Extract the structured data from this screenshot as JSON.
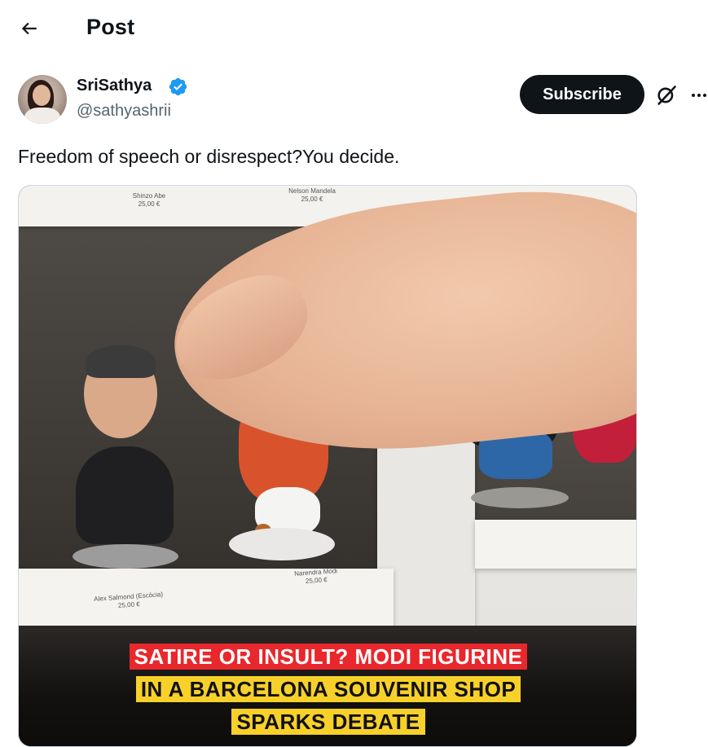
{
  "header": {
    "title": "Post",
    "back_icon": "arrow-left-icon"
  },
  "author": {
    "display_name": "SriSathya",
    "handle": "@sathyashrii",
    "verified": true,
    "verified_color": "#1d9bf0"
  },
  "actions": {
    "subscribe_label": "Subscribe",
    "grok_icon": "grok-icon",
    "more_icon": "more-horizontal-icon"
  },
  "tweet": {
    "text": "Freedom of speech or disrespect?You decide."
  },
  "media": {
    "price_tags": [
      {
        "name": "Shinzo Abe",
        "price": "25,00 €"
      },
      {
        "name": "Nelson Mandela",
        "price": "25,00 €"
      },
      {
        "name": "Alex Salmond (Escòcia)",
        "price": "25,00 €"
      },
      {
        "name": "Narendra Modi",
        "price": "25,00 €"
      }
    ],
    "caption_lines": [
      "SATIRE OR INSULT? MODI FIGURINE",
      "IN A BARCELONA SOUVENIR SHOP",
      "SPARKS DEBATE"
    ],
    "caption_colors": {
      "red": "#e8282c",
      "yellow": "#f7d02a"
    }
  }
}
